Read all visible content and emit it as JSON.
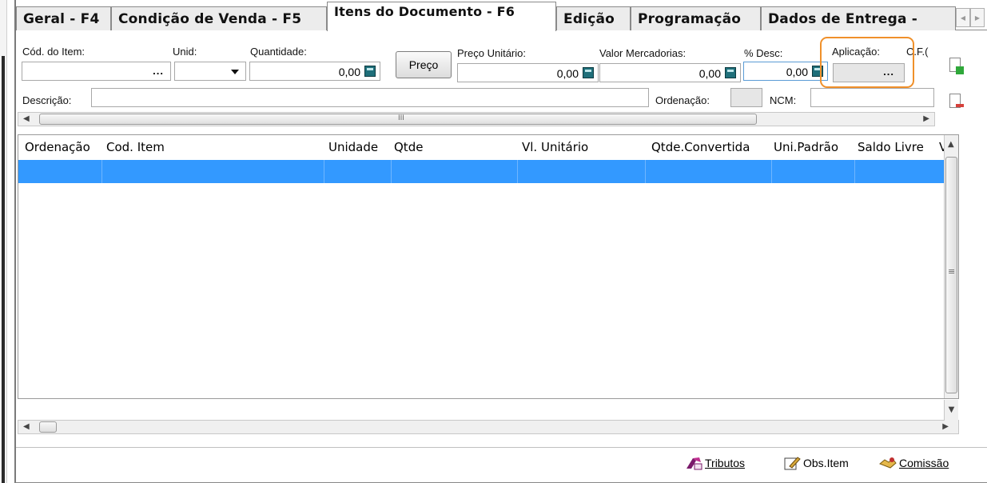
{
  "tabs": [
    {
      "label": "Geral - F4"
    },
    {
      "label": "Condição de Venda - F5"
    },
    {
      "label": "Itens do Documento - F6"
    },
    {
      "label": "Edição"
    },
    {
      "label": "Programação"
    },
    {
      "label": "Dados de Entrega -"
    }
  ],
  "active_tab": "Itens do Documento - F6",
  "form": {
    "cod_item_label": "Cód. do Item:",
    "cod_item_value": "",
    "unid_label": "Unid:",
    "unid_value": "",
    "quantidade_label": "Quantidade:",
    "quantidade_value": "0,00",
    "preco_button": "Preço",
    "preco_unitario_label": "Preço Unitário:",
    "preco_unitario_value": "0,00",
    "valor_mercadorias_label": "Valor Mercadorias:",
    "valor_mercadorias_value": "0,00",
    "desc_label": "% Desc:",
    "desc_value": "0,00",
    "aplicacao_label": "Aplicação:",
    "cfop_label": "C.F.(",
    "descricao_label": "Descrição:",
    "descricao_value": "",
    "ordenacao_label": "Ordenação:",
    "ncm_label": "NCM:",
    "ellipsis": "..."
  },
  "grid": {
    "columns": [
      "Ordenação",
      "Cod. Item",
      "Unidade",
      "Qtde",
      "Vl. Unitário",
      "Qtde.Convertida",
      "Uni.Padrão",
      "Saldo Livre",
      "V"
    ],
    "scroll_thumb_glyph": "III",
    "vscroll_grip": "≡"
  },
  "footer": {
    "tributos": "Tributos",
    "obs_item": "Obs.Item",
    "comissao": "Comissão"
  },
  "colors": {
    "selection": "#3399ff",
    "highlight": "#f0902a"
  }
}
